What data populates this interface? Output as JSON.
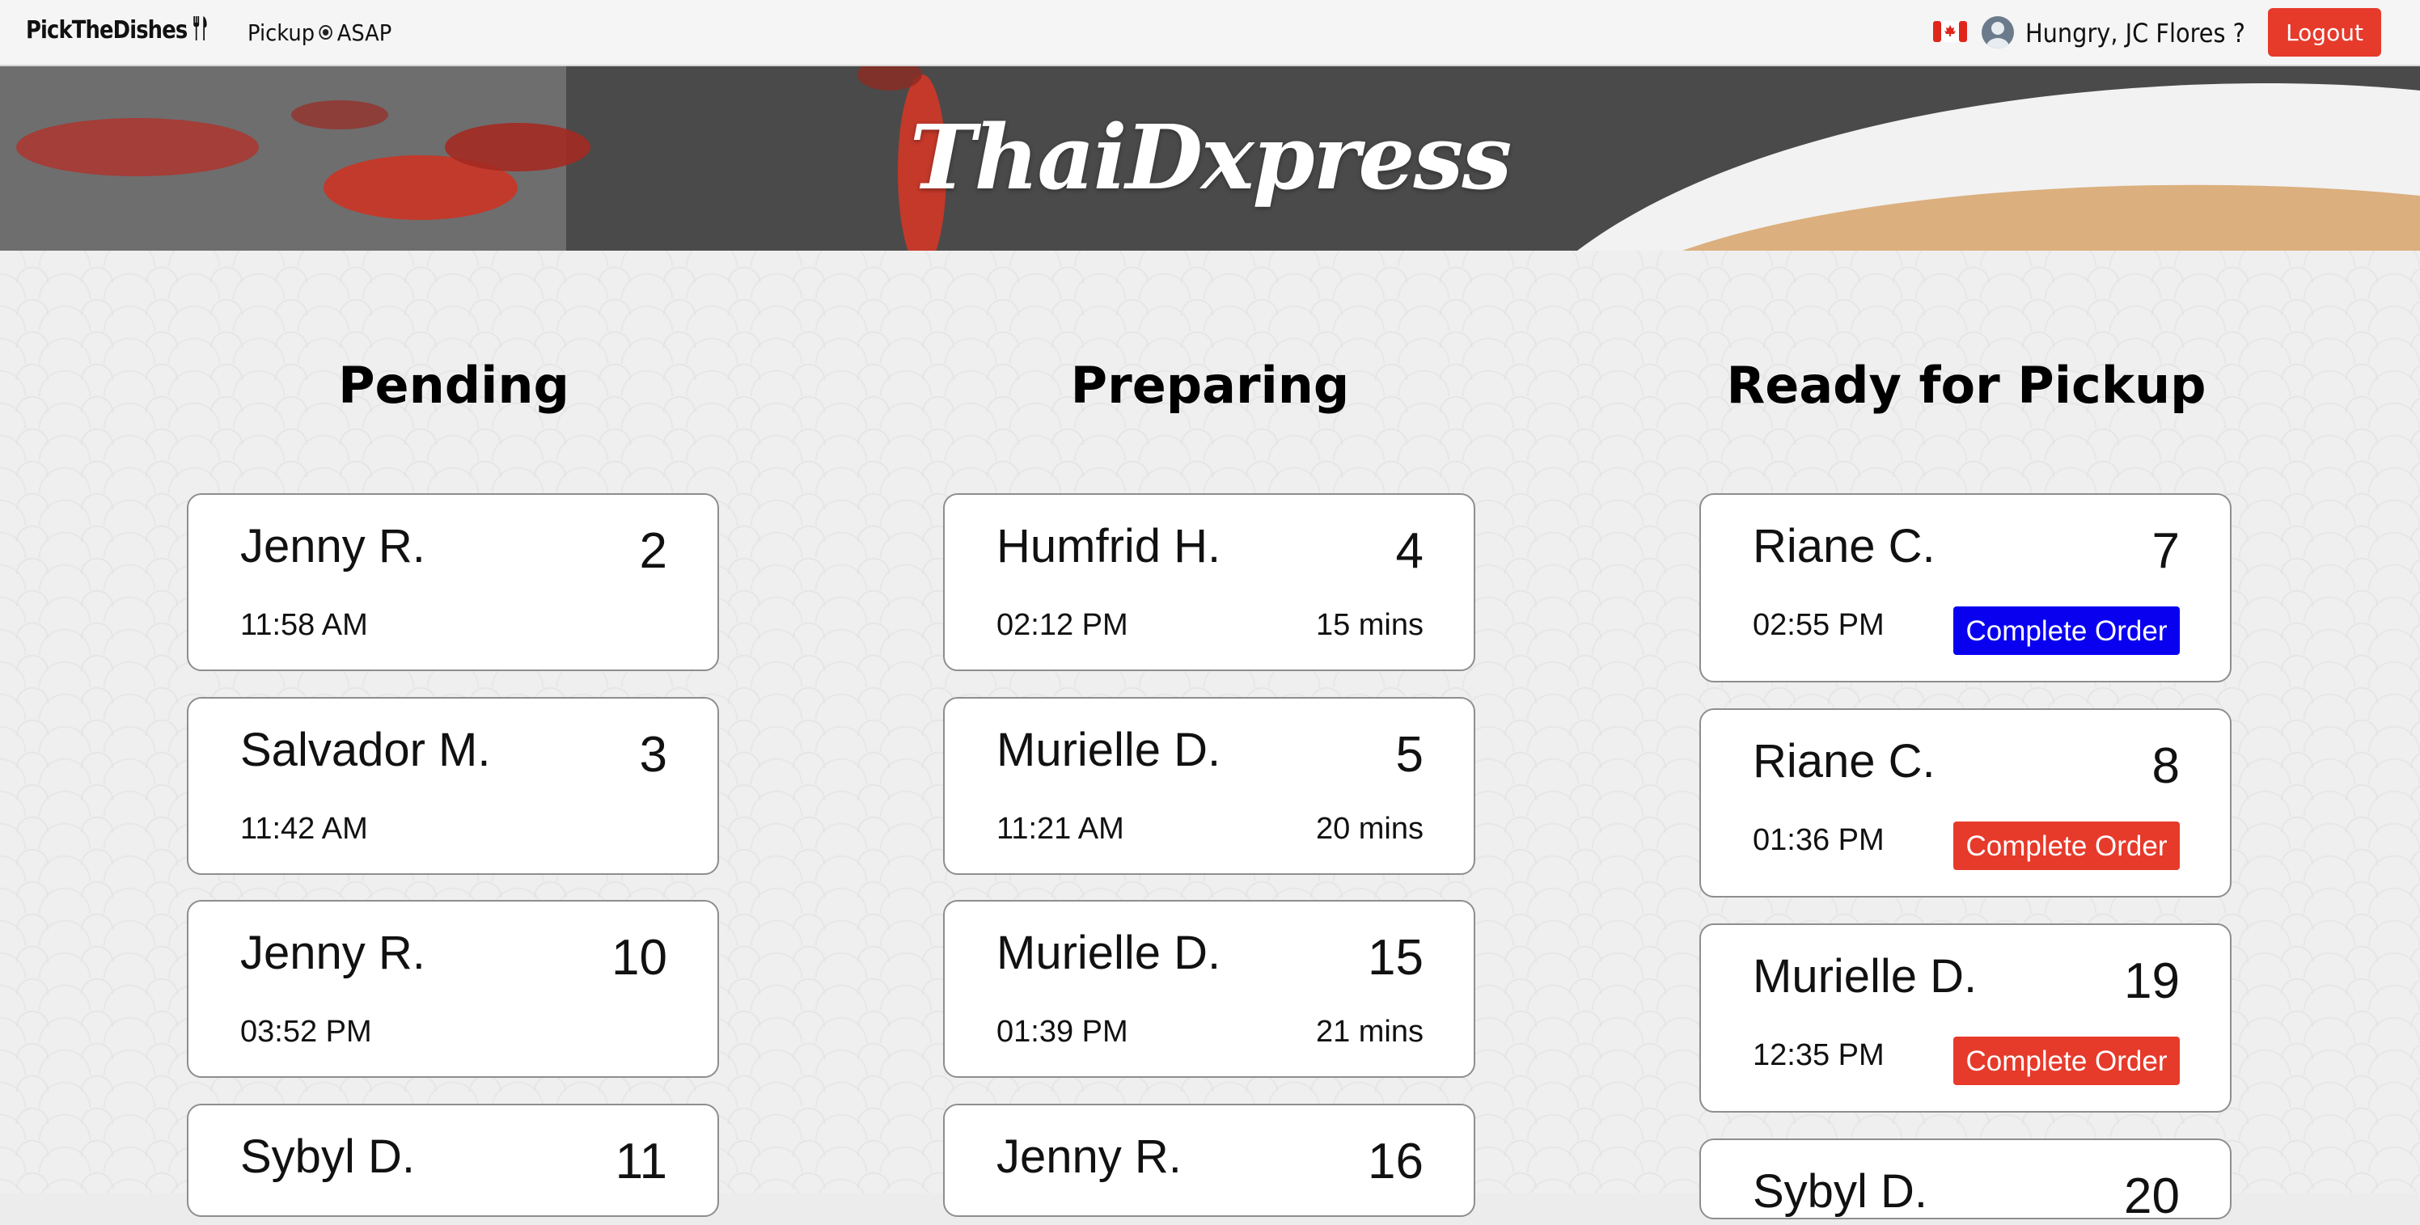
{
  "navbar": {
    "brand": "PickTheDishes",
    "pickup_label": "Pickup",
    "pickup_time": "ASAP",
    "greeting": "Hungry, JC Flores ?",
    "logout_label": "Logout"
  },
  "banner": {
    "restaurant_name": "ThaiDxpress"
  },
  "columns": {
    "pending": {
      "title": "Pending",
      "orders": [
        {
          "name": "Jenny R.",
          "number": "2",
          "time": "11:58 AM"
        },
        {
          "name": "Salvador M.",
          "number": "3",
          "time": "11:42 AM"
        },
        {
          "name": "Jenny R.",
          "number": "10",
          "time": "03:52 PM"
        },
        {
          "name": "Sybyl D.",
          "number": "11",
          "time": ""
        }
      ]
    },
    "preparing": {
      "title": "Preparing",
      "orders": [
        {
          "name": "Humfrid H.",
          "number": "4",
          "time": "02:12 PM",
          "duration": "15 mins"
        },
        {
          "name": "Murielle D.",
          "number": "5",
          "time": "11:21 AM",
          "duration": "20 mins"
        },
        {
          "name": "Murielle D.",
          "number": "15",
          "time": "01:39 PM",
          "duration": "21 mins"
        },
        {
          "name": "Jenny R.",
          "number": "16",
          "time": "",
          "duration": ""
        }
      ]
    },
    "ready": {
      "title": "Ready for Pickup",
      "complete_label": "Complete Order",
      "orders": [
        {
          "name": "Riane C.",
          "number": "7",
          "time": "02:55 PM",
          "button_color": "#0a00f0"
        },
        {
          "name": "Riane C.",
          "number": "8",
          "time": "01:36 PM",
          "button_color": "#e63a2b"
        },
        {
          "name": "Murielle D.",
          "number": "19",
          "time": "12:35 PM",
          "button_color": "#e63a2b"
        },
        {
          "name": "Sybyl D.",
          "number": "20",
          "time": ""
        }
      ]
    }
  },
  "colors": {
    "accent_red": "#e63a2b",
    "accent_blue": "#0a00f0"
  },
  "icons": {
    "brand": "cutlery-icon",
    "pickup": "radio-selected-icon",
    "flag": "canada-flag-icon",
    "user": "avatar-icon"
  }
}
